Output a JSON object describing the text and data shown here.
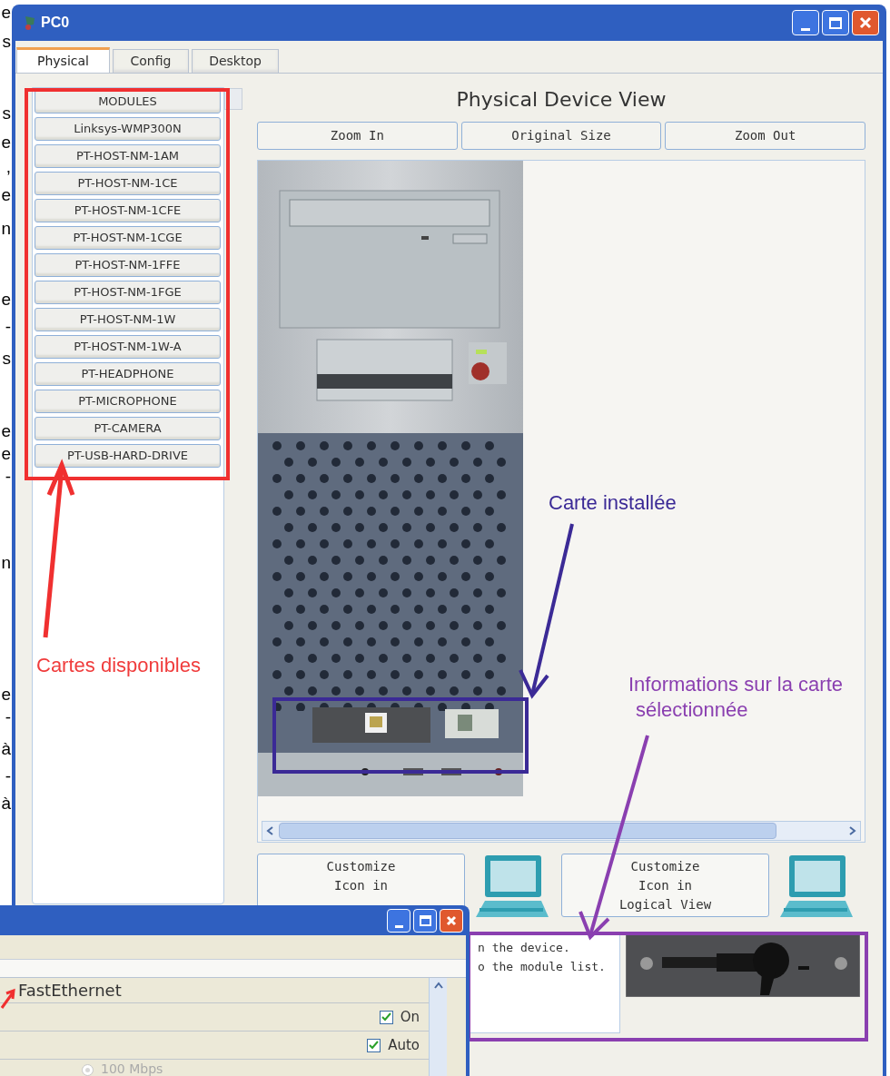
{
  "margin_fragments": [
    "e",
    "s",
    "s",
    "e",
    ",",
    "e",
    "n",
    "e",
    "-",
    "s",
    "e",
    "e",
    "-",
    "n",
    "e",
    "-",
    "à",
    "-",
    "à"
  ],
  "window": {
    "title": "PC0"
  },
  "tabs": [
    {
      "label": "Physical",
      "selected": true
    },
    {
      "label": "Config",
      "selected": false
    },
    {
      "label": "Desktop",
      "selected": false
    }
  ],
  "modules": [
    "MODULES",
    "Linksys-WMP300N",
    "PT-HOST-NM-1AM",
    "PT-HOST-NM-1CE",
    "PT-HOST-NM-1CFE",
    "PT-HOST-NM-1CGE",
    "PT-HOST-NM-1FFE",
    "PT-HOST-NM-1FGE",
    "PT-HOST-NM-1W",
    "PT-HOST-NM-1W-A",
    "PT-HEADPHONE",
    "PT-MICROPHONE",
    "PT-CAMERA",
    "PT-USB-HARD-DRIVE"
  ],
  "view_title": "Physical Device View",
  "zoom_buttons": [
    "Zoom In",
    "Original Size",
    "Zoom Out"
  ],
  "customize_buttons": [
    {
      "lines": [
        "Customize",
        "Icon in"
      ]
    },
    {
      "lines": [
        "Customize",
        "Icon in",
        "Logical View"
      ]
    }
  ],
  "module_info": [
    "n the device.",
    "o the module list."
  ],
  "annotations": [
    {
      "lines": [
        "Cartes disponibles"
      ],
      "color": "#f03c3c"
    },
    {
      "lines": [
        "Carte installée"
      ],
      "color": "#3b2a96"
    },
    {
      "lines": [
        "Informations sur la carte",
        "sélectionnée"
      ],
      "color": "#8a3fb0"
    }
  ],
  "second_window": {
    "section": "FastEthernet",
    "options": [
      {
        "label": "On",
        "checked": true
      },
      {
        "label": "Auto",
        "checked": true
      }
    ],
    "radio": {
      "label": "100 Mbps",
      "selected": false
    }
  }
}
